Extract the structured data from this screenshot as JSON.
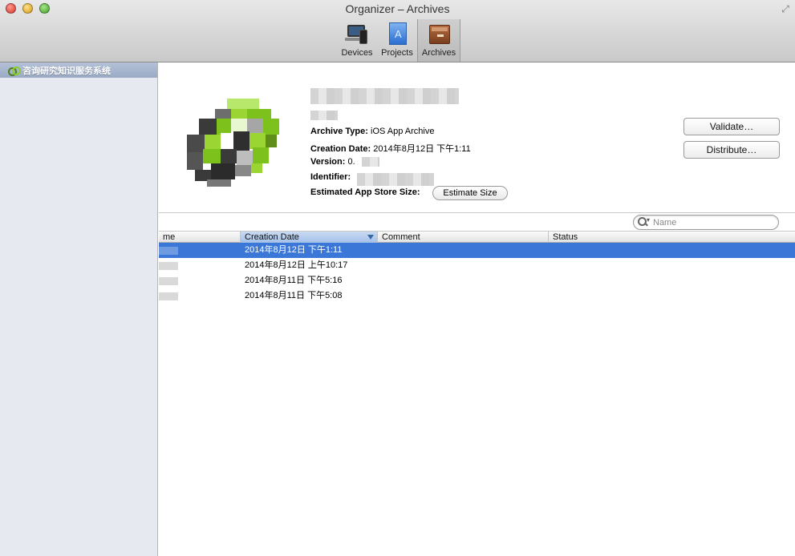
{
  "window": {
    "title": "Organizer – Archives"
  },
  "toolbar": {
    "tabs": [
      {
        "label": "Devices",
        "icon": "devices-icon",
        "active": false
      },
      {
        "label": "Projects",
        "icon": "projects-icon",
        "active": false
      },
      {
        "label": "Archives",
        "icon": "archives-icon",
        "active": true
      }
    ]
  },
  "sidebar": {
    "items": [
      {
        "label": "咨询研究知识服务系统",
        "icon": "app-link-icon",
        "selected": true
      }
    ]
  },
  "detail": {
    "archive_type_label": "Archive Type:",
    "archive_type_value": "iOS App Archive",
    "creation_date_label": "Creation Date:",
    "creation_date_value": "2014年8月12日 下午1:11",
    "version_label": "Version:",
    "version_value": "0.",
    "identifier_label": "Identifier:",
    "size_label": "Estimated App Store Size:",
    "estimate_button": "Estimate Size",
    "validate_button": "Validate…",
    "distribute_button": "Distribute…"
  },
  "search": {
    "placeholder": "Name",
    "value": ""
  },
  "table": {
    "columns": [
      {
        "label": "me",
        "sorted": false
      },
      {
        "label": "Creation Date",
        "sorted": true
      },
      {
        "label": "Comment",
        "sorted": false
      },
      {
        "label": "Status",
        "sorted": false
      }
    ],
    "rows": [
      {
        "creation_date": "2014年8月12日 下午1:11",
        "selected": true
      },
      {
        "creation_date": "2014年8月12日 上午10:17",
        "selected": false
      },
      {
        "creation_date": "2014年8月11日 下午5:16",
        "selected": false
      },
      {
        "creation_date": "2014年8月11日 下午5:08",
        "selected": false
      }
    ]
  },
  "colors": {
    "selection": "#3a77d6",
    "sidebar_selection": "#9aaac6",
    "sidebar_bg": "#e6eaf0",
    "icon_green": "#8ccf2a"
  }
}
